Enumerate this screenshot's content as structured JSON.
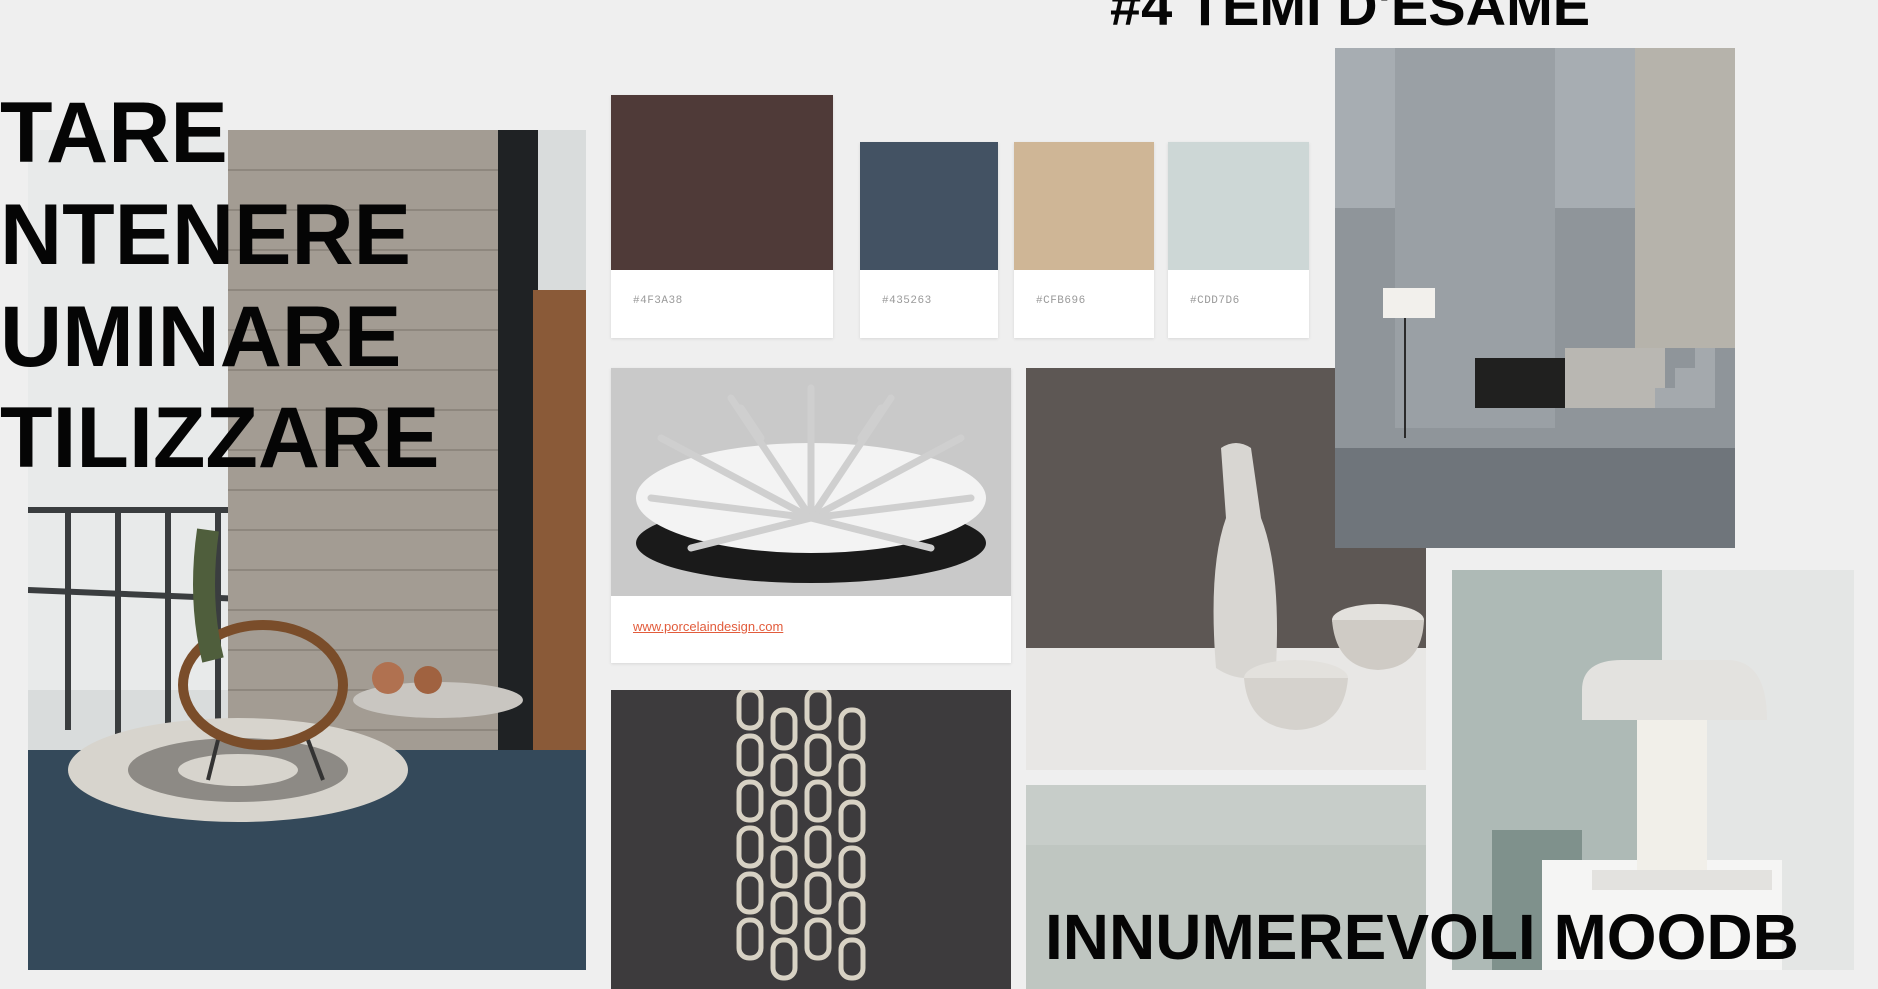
{
  "heading_top": "#4 TEMI D'ESAME",
  "heading_bottom": "INNUMEREVOLI MOODB",
  "verbs": [
    "TARE",
    "NTENERE",
    "UMINARE",
    "TILIZZARE"
  ],
  "palette": [
    {
      "hex_label": "#4F3A38",
      "color": "#4f3a38"
    },
    {
      "hex_label": "#435263",
      "color": "#435263"
    },
    {
      "hex_label": "#CFB696",
      "color": "#cfb696"
    },
    {
      "hex_label": "#CDD7D6",
      "color": "#cdd7d6"
    }
  ],
  "coral_card": {
    "link": "www.porcelaindesign.com"
  },
  "images": {
    "patio": "patio-icon",
    "coral": "coral-sculpture-icon",
    "chain": "chain-icon",
    "vases": "ceramic-vases-icon",
    "interior": "concrete-interior-icon",
    "lamp": "concrete-lamp-icon",
    "panel": "sage-panel-icon"
  }
}
